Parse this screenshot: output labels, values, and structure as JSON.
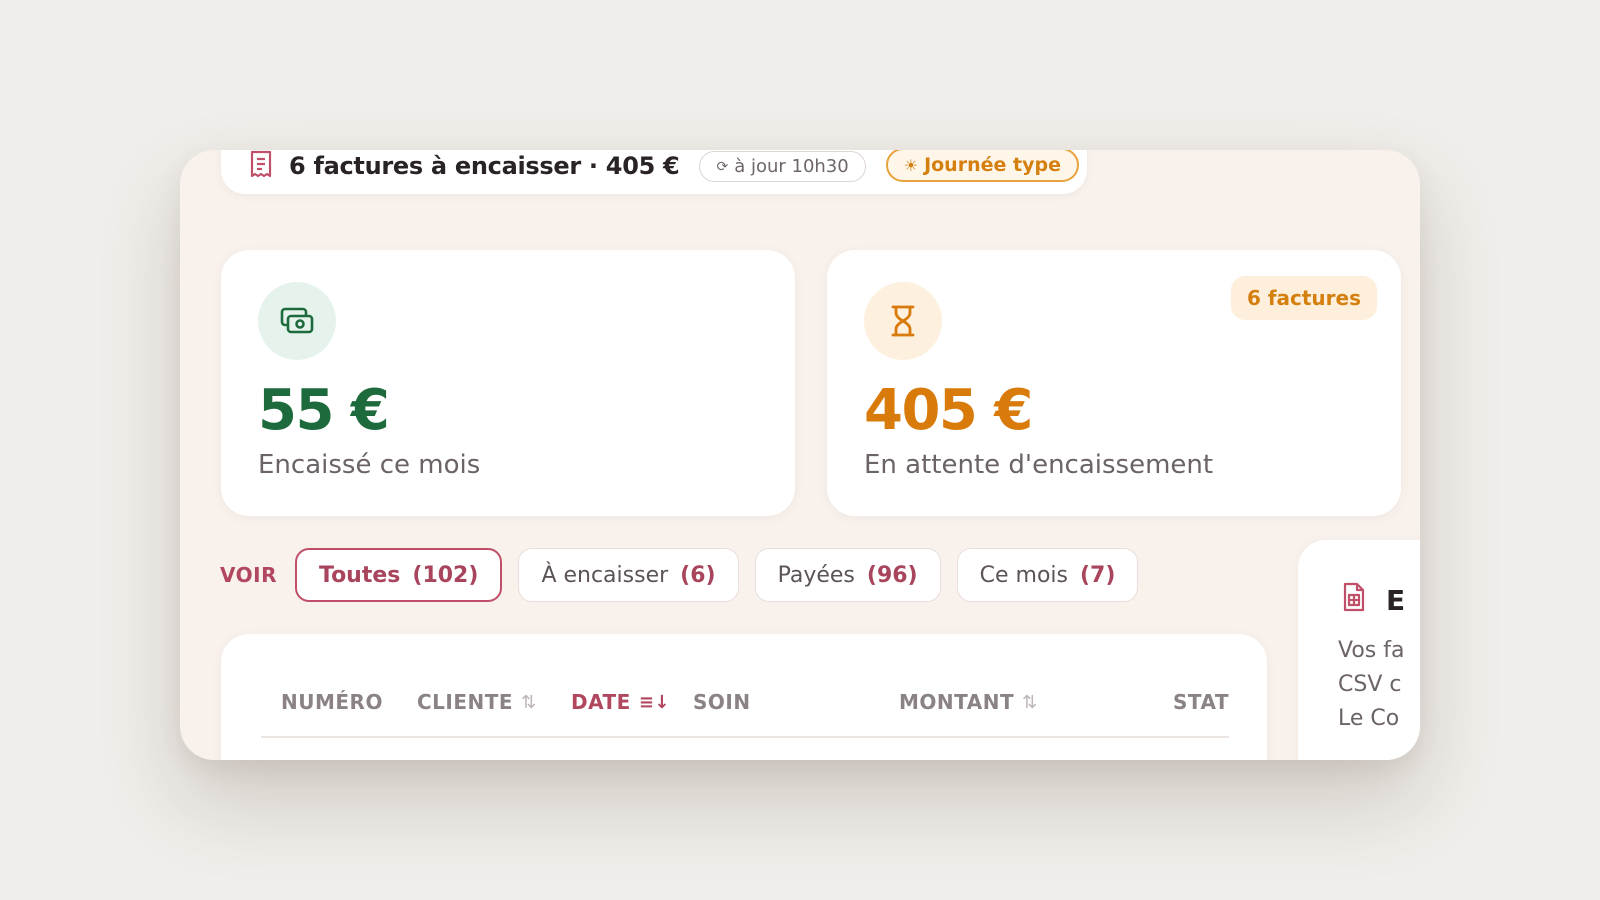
{
  "topbar": {
    "title": "6 factures à encaisser · 405 €",
    "sync_label": "à jour 10h30",
    "day_label": "Journée type",
    "icons": [
      "receipt-icon",
      "refresh-icon",
      "sun-icon"
    ]
  },
  "cards": [
    {
      "icon": "cash-icon",
      "amount": "55 €",
      "label": "Encaissé ce mois"
    },
    {
      "icon": "hourglass-icon",
      "amount": "405 €",
      "label": "En attente d'encaissement",
      "badge": "6 factures"
    }
  ],
  "filters": {
    "label": "VOIR",
    "chips": [
      {
        "label": "Toutes",
        "count": "(102)",
        "active": true
      },
      {
        "label": "À encaisser",
        "count": "(6)",
        "active": false
      },
      {
        "label": "Payées",
        "count": "(96)",
        "active": false
      },
      {
        "label": "Ce mois",
        "count": "(7)",
        "active": false
      }
    ]
  },
  "table": {
    "columns": [
      {
        "label": "NUMÉRO",
        "sort": ""
      },
      {
        "label": "CLIENTE",
        "sort": "⇅"
      },
      {
        "label": "DATE",
        "sort": "≡↓"
      },
      {
        "label": "SOIN",
        "sort": ""
      },
      {
        "label": "MONTANT",
        "sort": "⇅"
      },
      {
        "label": "STAT",
        "sort": ""
      }
    ],
    "sorted_column": "DATE"
  },
  "side_card": {
    "icon": "spreadsheet-file-icon",
    "title": "E",
    "lines": [
      "Vos fa",
      "CSV c",
      "Le Co"
    ]
  },
  "colors": {
    "accent": "#b0475f",
    "positive": "#1d6b3d",
    "pending": "#d97b0b",
    "background": "#f8f1ec"
  }
}
